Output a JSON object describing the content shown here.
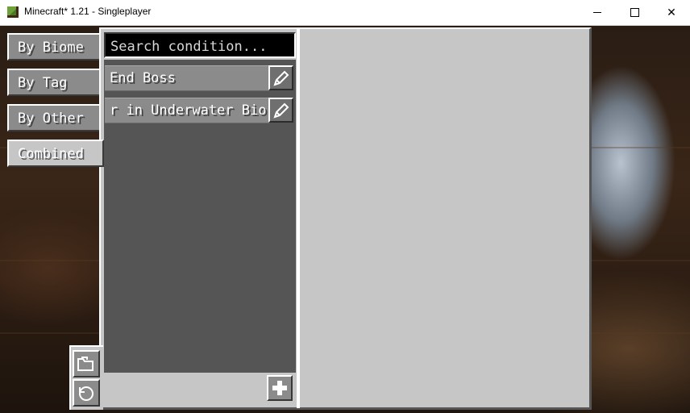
{
  "window": {
    "title": "Minecraft* 1.21 - Singleplayer",
    "minimize_icon": "minimize-icon",
    "maximize_icon": "maximize-icon",
    "close_label": "✕"
  },
  "tabs": [
    {
      "label": "By Biome",
      "active": false
    },
    {
      "label": "By Tag",
      "active": false
    },
    {
      "label": "By Other",
      "active": false
    },
    {
      "label": "Combined",
      "active": true
    }
  ],
  "search": {
    "placeholder": "Search condition..."
  },
  "conditions": [
    {
      "label": "End Boss",
      "edit_icon": "pencil-icon"
    },
    {
      "label": "r in Underwater Bio",
      "edit_icon": "pencil-icon"
    }
  ],
  "buttons": {
    "add_icon": "plus-icon",
    "folder_icon": "folder-icon",
    "reload_icon": "reload-icon"
  },
  "colors": {
    "panel": "#c6c6c6",
    "list_bg": "#555555",
    "item_bg": "#8b8b8b",
    "search_bg": "#000000"
  }
}
